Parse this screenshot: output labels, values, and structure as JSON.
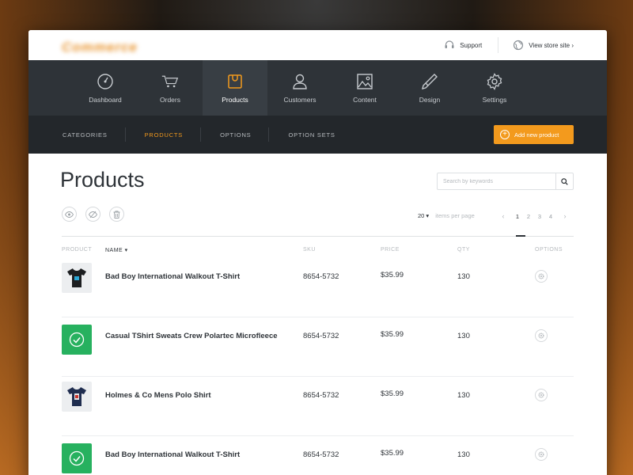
{
  "header": {
    "logo_text": "Commerce",
    "support_label": "Support",
    "view_store_label": "View store site ›"
  },
  "nav": {
    "items": [
      {
        "label": "Dashboard",
        "icon": "dashboard-icon"
      },
      {
        "label": "Orders",
        "icon": "cart-icon"
      },
      {
        "label": "Products",
        "icon": "shopping-bag-icon"
      },
      {
        "label": "Customers",
        "icon": "user-icon"
      },
      {
        "label": "Content",
        "icon": "image-icon"
      },
      {
        "label": "Design",
        "icon": "brush-icon"
      },
      {
        "label": "Settings",
        "icon": "gear-icon"
      }
    ],
    "active": "Products"
  },
  "subnav": {
    "items": [
      "CATEGORIES",
      "PRODUCTS",
      "OPTIONS",
      "OPTION SETS"
    ],
    "active": "PRODUCTS",
    "add_button_label": "Add new product"
  },
  "page": {
    "title": "Products",
    "search_placeholder": "Search by keywords",
    "per_page_value": "20 ▾",
    "per_page_label": "items per page",
    "pagination": {
      "prev": "‹",
      "pages": [
        "1",
        "2",
        "3",
        "4"
      ],
      "next": "›",
      "current": "1"
    }
  },
  "table": {
    "headers": {
      "product": "PRODUCT",
      "name": "NAME ▾",
      "sku": "SKU",
      "price": "PRICE",
      "qty": "QTY",
      "options": "OPTIONS"
    },
    "rows": [
      {
        "name": "Bad Boy International Walkout T-Shirt",
        "sku": "8654-5732",
        "price": "$35.99",
        "qty": "130",
        "thumb": "tshirt-black"
      },
      {
        "name": "Casual TShirt Sweats Crew Polartec Microfleece",
        "sku": "8654-5732",
        "price": "$35.99",
        "qty": "130",
        "thumb": "selected-check"
      },
      {
        "name": "Holmes & Co Mens Polo Shirt",
        "sku": "8654-5732",
        "price": "$35.99",
        "qty": "130",
        "thumb": "tshirt-navy"
      },
      {
        "name": "Bad Boy International Walkout T-Shirt",
        "sku": "8654-5732",
        "price": "$35.99",
        "qty": "130",
        "thumb": "selected-check"
      }
    ]
  },
  "colors": {
    "accent": "#f39a1d",
    "nav_bg": "#2e3338",
    "subnav_bg": "#23272b",
    "selected_green": "#27b15f"
  }
}
